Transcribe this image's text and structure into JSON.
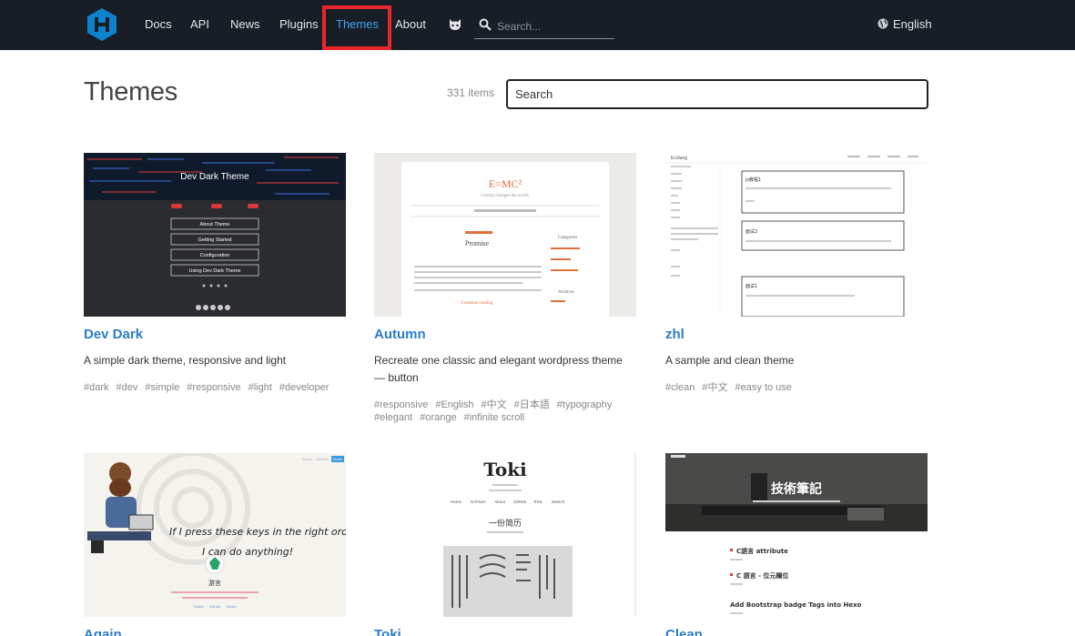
{
  "nav": {
    "items": [
      "Docs",
      "API",
      "News",
      "Plugins",
      "Themes",
      "About"
    ],
    "active": "Themes",
    "search_placeholder": "Search...",
    "language": "English"
  },
  "header": {
    "title": "Themes",
    "count": "331 items",
    "search_placeholder": "Search"
  },
  "themes": [
    {
      "name": "Dev Dark",
      "description": "A simple dark theme, responsive and light",
      "tags": [
        "#dark",
        "#dev",
        "#simple",
        "#responsive",
        "#light",
        "#developer"
      ],
      "preview": {
        "heading": "Dev Dark Theme",
        "menu": [
          "About Theme",
          "Getting Started",
          "Configuration",
          "Using Dev Dark Theme"
        ]
      }
    },
    {
      "name": "Autumn",
      "description": "Recreate one classic and elegant wordpress theme — button",
      "tags": [
        "#responsive",
        "#English",
        "#中文",
        "#日本語",
        "#typography",
        "#elegant",
        "#orange",
        "#infinite scroll"
      ],
      "preview": {
        "heading": "E=MC²",
        "subtitle": "Coding changes the world.",
        "post_title": "Promise",
        "sidebar_1": "Categories",
        "sidebar_2": "Archives",
        "more": "Continue reading"
      }
    },
    {
      "name": "zhl",
      "description": "A sample and clean theme",
      "tags": [
        "#clean",
        "#中文",
        "#easy to use"
      ],
      "preview": {
        "brand": "Ecdiang",
        "posts": [
          "js教程1",
          "面试2",
          "面试1"
        ]
      }
    },
    {
      "name": "Again",
      "preview": {
        "quote_1": "If I press these keys in the right order,",
        "quote_2": "I can do anything!",
        "name": "游言",
        "nav": [
          "About",
          "Archive",
          "Home"
        ],
        "links": [
          "Twitter",
          "GitHub",
          "Weibo"
        ]
      }
    },
    {
      "name": "Toki",
      "preview": {
        "logo": "Toki",
        "nav": [
          "Home",
          "Archives",
          "About",
          "GitHub",
          "RSS",
          "Search"
        ],
        "post_title": "一份简历"
      }
    },
    {
      "name": "Clean",
      "preview": {
        "heading": "技術筆記",
        "posts": [
          "C語言 attribute",
          "C 語言 - 位元欄位",
          "Add Bootstrap badge Tags into Hexo"
        ]
      }
    }
  ],
  "colors": {
    "nav_bg": "#171e26",
    "accent": "#2a7dc8",
    "active": "#3fa3f0",
    "highlight": "#e8262b"
  }
}
